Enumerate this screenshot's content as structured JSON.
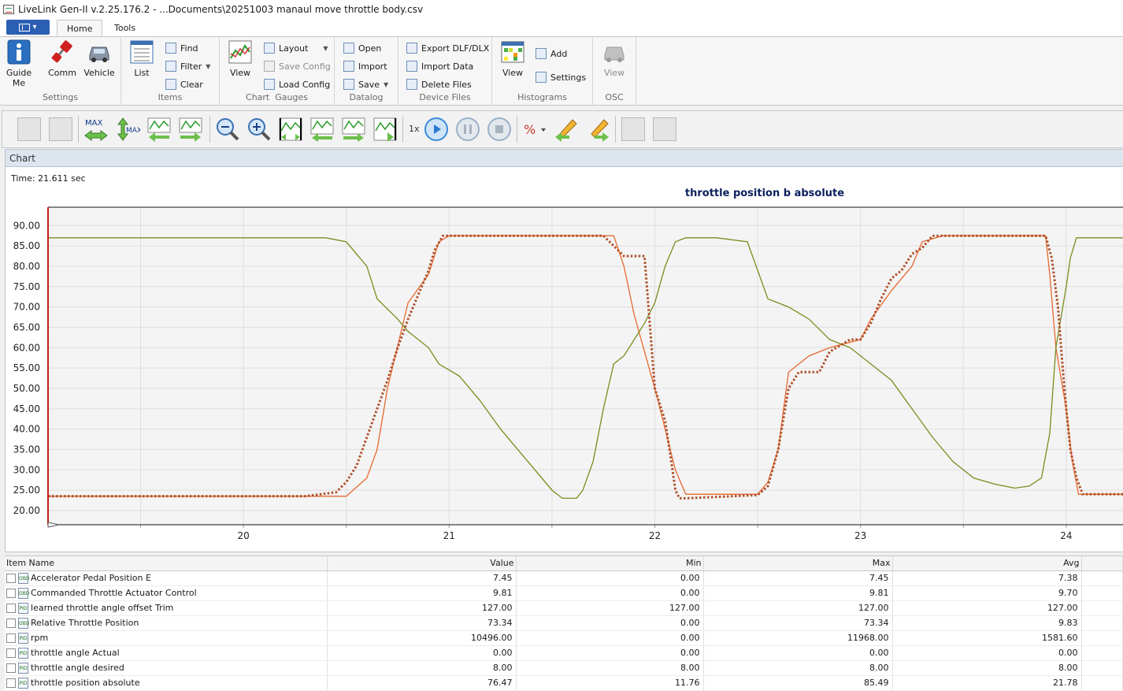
{
  "window": {
    "title": "LiveLink Gen-II  v.2.25.176.2 - ...Documents\\20251003 manaul move throttle body.csv"
  },
  "ribbon": {
    "tabs": [
      "Home",
      "Tools"
    ],
    "groups": {
      "settings": {
        "label": "Settings",
        "guide": "Guide\nMe",
        "comm": "Comm",
        "vehicle": "Vehicle"
      },
      "items": {
        "label": "Items",
        "list": "List",
        "find": "Find",
        "filter": "Filter",
        "clear": "Clear"
      },
      "chart_gauges": {
        "label": "Chart  Gauges",
        "view": "View",
        "layout": "Layout",
        "save_config": "Save Config",
        "load_config": "Load Config"
      },
      "datalog": {
        "label": "Datalog",
        "open": "Open",
        "import": "Import",
        "save": "Save"
      },
      "device_files": {
        "label": "Device Files",
        "export": "Export DLF/DLX",
        "import_data": "Import Data",
        "delete_files": "Delete Files"
      },
      "histograms": {
        "label": "Histograms",
        "view": "View",
        "add": "Add",
        "settings": "Settings"
      },
      "osc": {
        "label": "OSC",
        "view": "View"
      }
    }
  },
  "toolbar": {
    "speed_label": "1x"
  },
  "chart_panel": {
    "header": "Chart",
    "time_readout": "Time: 21.611 sec"
  },
  "chart_data": {
    "type": "line",
    "title": "throttle position b absolute",
    "xlim": [
      19.05,
      24.28
    ],
    "ylim": [
      16.5,
      94.5
    ],
    "xticks": [
      20,
      21,
      22,
      23,
      24
    ],
    "yticks": [
      20.0,
      25.0,
      30.0,
      35.0,
      40.0,
      45.0,
      50.0,
      55.0,
      60.0,
      65.0,
      70.0,
      75.0,
      80.0,
      85.0,
      90.0
    ],
    "grid": true,
    "series": [
      {
        "style": "dotted",
        "color": "#b0502a",
        "x": [
          19.05,
          20.3,
          20.45,
          20.5,
          20.55,
          20.6,
          20.65,
          20.7,
          20.75,
          20.8,
          20.85,
          20.9,
          20.93,
          20.97,
          21.75,
          21.8,
          21.85,
          21.95,
          22.0,
          22.05,
          22.08,
          22.1,
          22.12,
          22.15,
          22.5,
          22.55,
          22.6,
          22.65,
          22.7,
          22.8,
          22.85,
          22.95,
          23.0,
          23.05,
          23.1,
          23.15,
          23.2,
          23.25,
          23.3,
          23.35,
          23.4,
          23.45,
          23.9,
          23.93,
          23.96,
          23.98,
          24.0,
          24.02,
          24.05,
          24.08,
          24.28
        ],
        "y": [
          23.5,
          23.5,
          24.5,
          27.0,
          31.0,
          38.0,
          45.0,
          52.0,
          60.0,
          67.0,
          73.0,
          79.0,
          84.0,
          87.5,
          87.5,
          85.0,
          82.5,
          82.5,
          50.0,
          42.0,
          32.0,
          25.0,
          23.0,
          23.0,
          23.8,
          26.0,
          35.0,
          50.0,
          54.0,
          54.0,
          59.0,
          62.0,
          62.0,
          66.0,
          72.0,
          77.0,
          79.0,
          83.0,
          84.5,
          87.5,
          87.5,
          87.5,
          87.5,
          82.0,
          70.0,
          57.0,
          45.0,
          35.0,
          28.0,
          24.0,
          24.0
        ]
      },
      {
        "style": "solid",
        "color": "#e6692f",
        "x": [
          19.05,
          20.5,
          20.6,
          20.65,
          20.7,
          20.8,
          20.9,
          20.95,
          21.0,
          21.8,
          21.85,
          21.9,
          22.0,
          22.05,
          22.1,
          22.15,
          22.5,
          22.55,
          22.6,
          22.65,
          22.75,
          22.85,
          23.0,
          23.05,
          23.15,
          23.25,
          23.3,
          23.4,
          23.45,
          23.9,
          23.92,
          23.95,
          24.0,
          24.03,
          24.06,
          24.28
        ],
        "y": [
          23.5,
          23.5,
          28.0,
          35.0,
          50.0,
          71.0,
          78.0,
          86.0,
          87.5,
          87.5,
          80.0,
          68.0,
          50.0,
          40.0,
          30.0,
          24.0,
          24.0,
          27.0,
          35.0,
          54.0,
          58.0,
          60.0,
          62.0,
          67.0,
          74.0,
          80.0,
          86.0,
          87.5,
          87.5,
          87.5,
          78.0,
          60.0,
          45.0,
          32.0,
          24.0,
          24.0
        ]
      },
      {
        "style": "solid",
        "color": "#7a8c1e",
        "x": [
          19.05,
          20.4,
          20.5,
          20.6,
          20.65,
          20.75,
          20.8,
          20.9,
          20.95,
          21.05,
          21.15,
          21.25,
          21.35,
          21.4,
          21.5,
          21.55,
          21.62,
          21.65,
          21.7,
          21.75,
          21.8,
          21.85,
          21.9,
          21.95,
          22.0,
          22.05,
          22.1,
          22.15,
          22.3,
          22.45,
          22.55,
          22.65,
          22.75,
          22.85,
          22.95,
          23.05,
          23.15,
          23.25,
          23.35,
          23.45,
          23.55,
          23.65,
          23.75,
          23.82,
          23.88,
          23.92,
          23.95,
          24.0,
          24.02,
          24.05,
          24.28
        ],
        "y": [
          87.0,
          87.0,
          86.0,
          80.0,
          72.0,
          67.0,
          64.0,
          60.0,
          56.0,
          53.0,
          47.0,
          40.0,
          34.0,
          31.0,
          25.0,
          23.0,
          23.0,
          25.0,
          32.0,
          45.0,
          56.0,
          58.0,
          62.0,
          66.0,
          71.0,
          80.0,
          86.0,
          87.0,
          87.0,
          86.0,
          72.0,
          70.0,
          67.0,
          62.0,
          60.0,
          56.0,
          52.0,
          45.0,
          38.0,
          32.0,
          28.0,
          26.5,
          25.5,
          26.0,
          28.0,
          39.0,
          60.0,
          75.0,
          82.0,
          87.0,
          87.0
        ]
      }
    ]
  },
  "grid": {
    "columns": [
      "Item Name",
      "Value",
      "Min",
      "Max",
      "Avg"
    ],
    "rows": [
      {
        "name": "Accelerator Pedal Position E",
        "icon": "obd-icon",
        "value": "7.45",
        "min": "0.00",
        "max": "7.45",
        "avg": "7.38"
      },
      {
        "name": "Commanded Throttle Actuator Control",
        "icon": "obd-icon",
        "value": "9.81",
        "min": "0.00",
        "max": "9.81",
        "avg": "9.70"
      },
      {
        "name": "learned throttle angle offset Trim",
        "icon": "pid-icon",
        "value": "127.00",
        "min": "127.00",
        "max": "127.00",
        "avg": "127.00"
      },
      {
        "name": "Relative Throttle Position",
        "icon": "obd-icon",
        "value": "73.34",
        "min": "0.00",
        "max": "73.34",
        "avg": "9.83"
      },
      {
        "name": "rpm",
        "icon": "pid-icon",
        "value": "10496.00",
        "min": "0.00",
        "max": "11968.00",
        "avg": "1581.60"
      },
      {
        "name": "throttle angle Actual",
        "icon": "pid-icon",
        "value": "0.00",
        "min": "0.00",
        "max": "0.00",
        "avg": "0.00"
      },
      {
        "name": "throttle angle desired",
        "icon": "pid-icon",
        "value": "8.00",
        "min": "8.00",
        "max": "8.00",
        "avg": "8.00"
      },
      {
        "name": "throttle position absolute",
        "icon": "pid-icon",
        "value": "76.47",
        "min": "11.76",
        "max": "85.49",
        "avg": "21.78"
      }
    ]
  }
}
